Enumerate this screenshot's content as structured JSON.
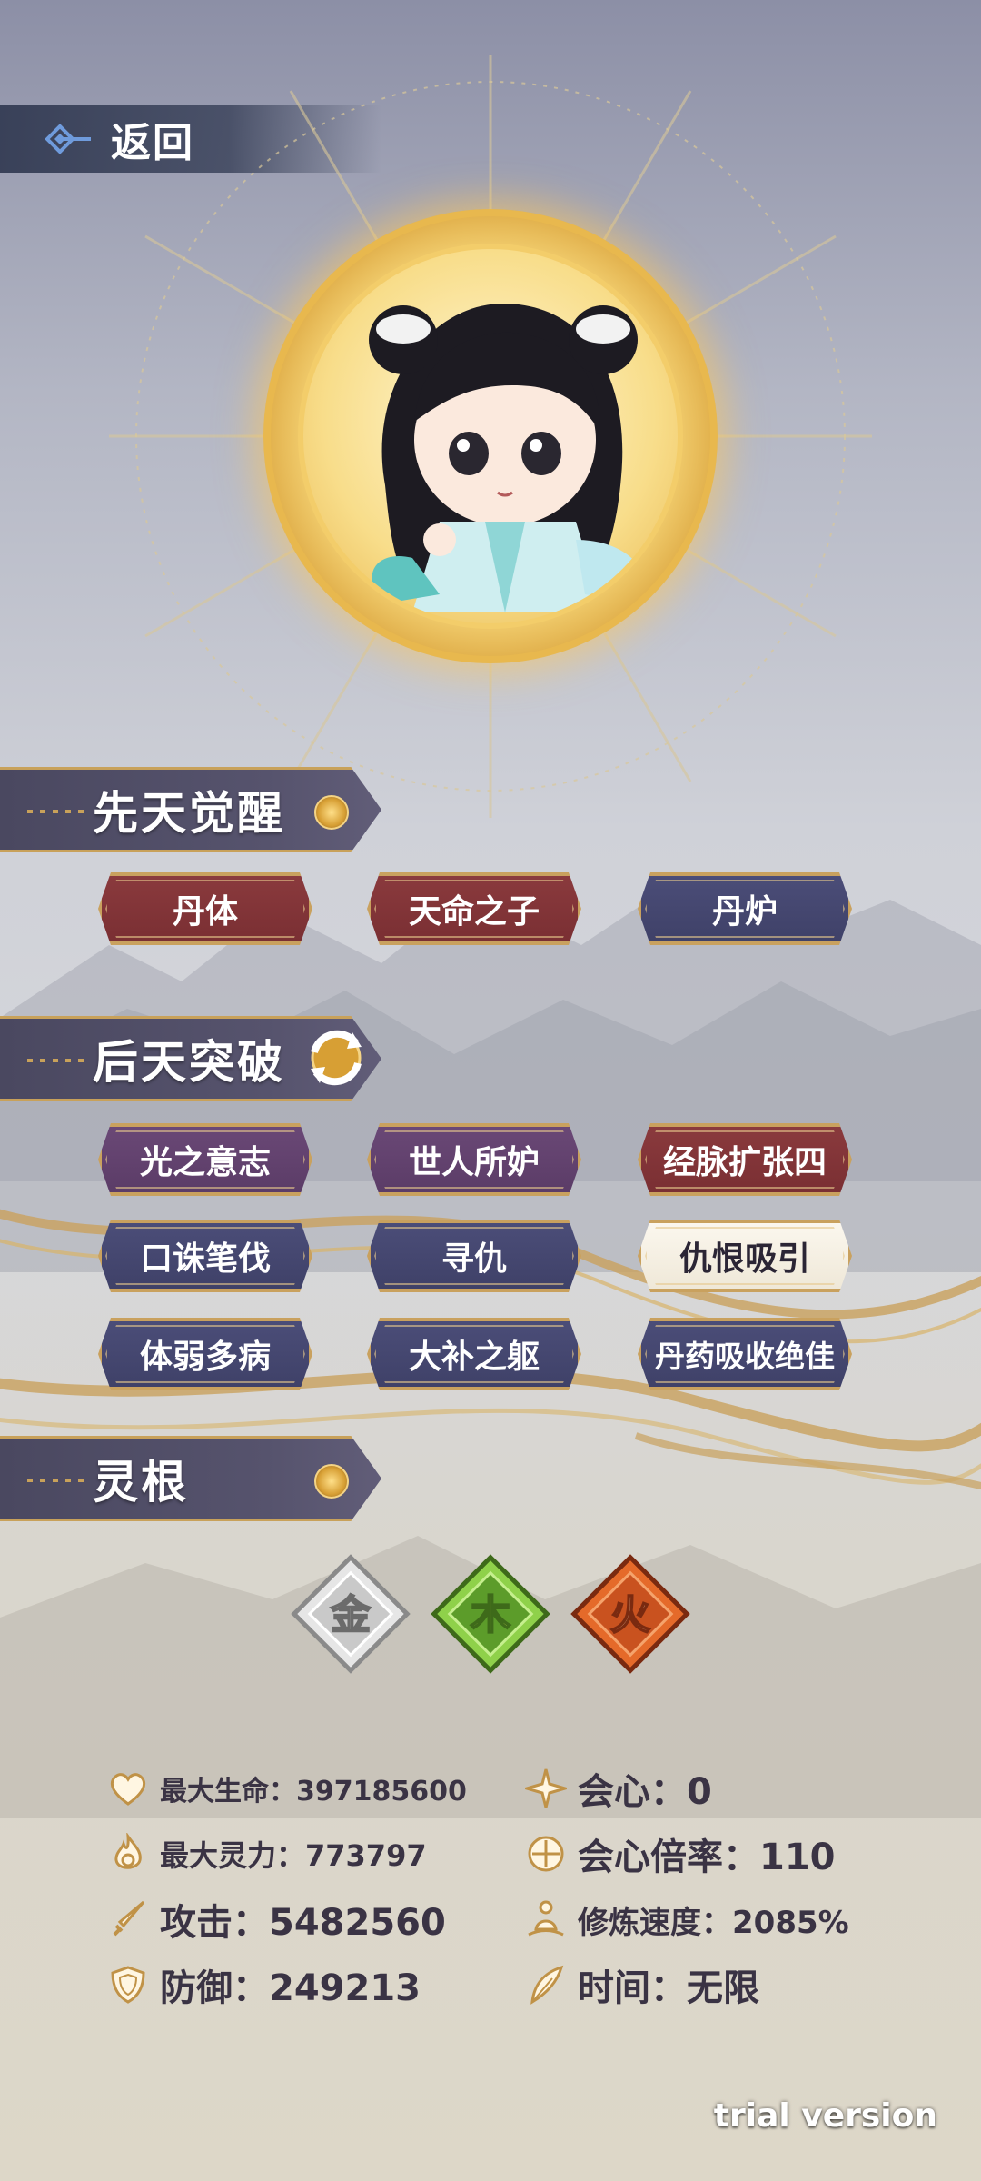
{
  "nav": {
    "back_label": "返回"
  },
  "sections": {
    "innate": {
      "title": "先天觉醒",
      "tags": [
        {
          "label": "丹体",
          "style": "red"
        },
        {
          "label": "天命之子",
          "style": "red"
        },
        {
          "label": "丹炉",
          "style": "navy"
        }
      ]
    },
    "acquired": {
      "title": "后天突破",
      "tags": [
        {
          "label": "光之意志",
          "style": "purple"
        },
        {
          "label": "世人所妒",
          "style": "purple"
        },
        {
          "label": "经脉扩张四",
          "style": "red"
        },
        {
          "label": "口诛笔伐",
          "style": "navy"
        },
        {
          "label": "寻仇",
          "style": "navy"
        },
        {
          "label": "仇恨吸引",
          "style": "white"
        },
        {
          "label": "体弱多病",
          "style": "navy"
        },
        {
          "label": "大补之躯",
          "style": "navy"
        },
        {
          "label": "丹药吸收绝佳",
          "style": "navy"
        }
      ]
    },
    "spirit_root": {
      "title": "灵根",
      "elements": [
        {
          "glyph": "金",
          "icon": "metal-element-icon",
          "color": "#b9b9b9"
        },
        {
          "glyph": "木",
          "icon": "wood-element-icon",
          "color": "#6aa52d"
        },
        {
          "glyph": "火",
          "icon": "fire-element-icon",
          "color": "#c9521f"
        }
      ]
    }
  },
  "stats": {
    "max_hp": "最大生命：397185600",
    "max_spirit": "最大灵力：773797",
    "attack": "攻击：5482560",
    "defense": "防御：249213",
    "crit": "会心：0",
    "crit_multiplier": "会心倍率：110",
    "cultivation_speed": "修炼速度：2085%",
    "time": "时间：无限"
  },
  "watermark": "trial version",
  "colors": {
    "gold": "#c9a15e",
    "header_bg": "#4a4860",
    "tag_red": "#7a2f33",
    "tag_navy": "#3f4168",
    "tag_purple": "#5b3c67"
  }
}
